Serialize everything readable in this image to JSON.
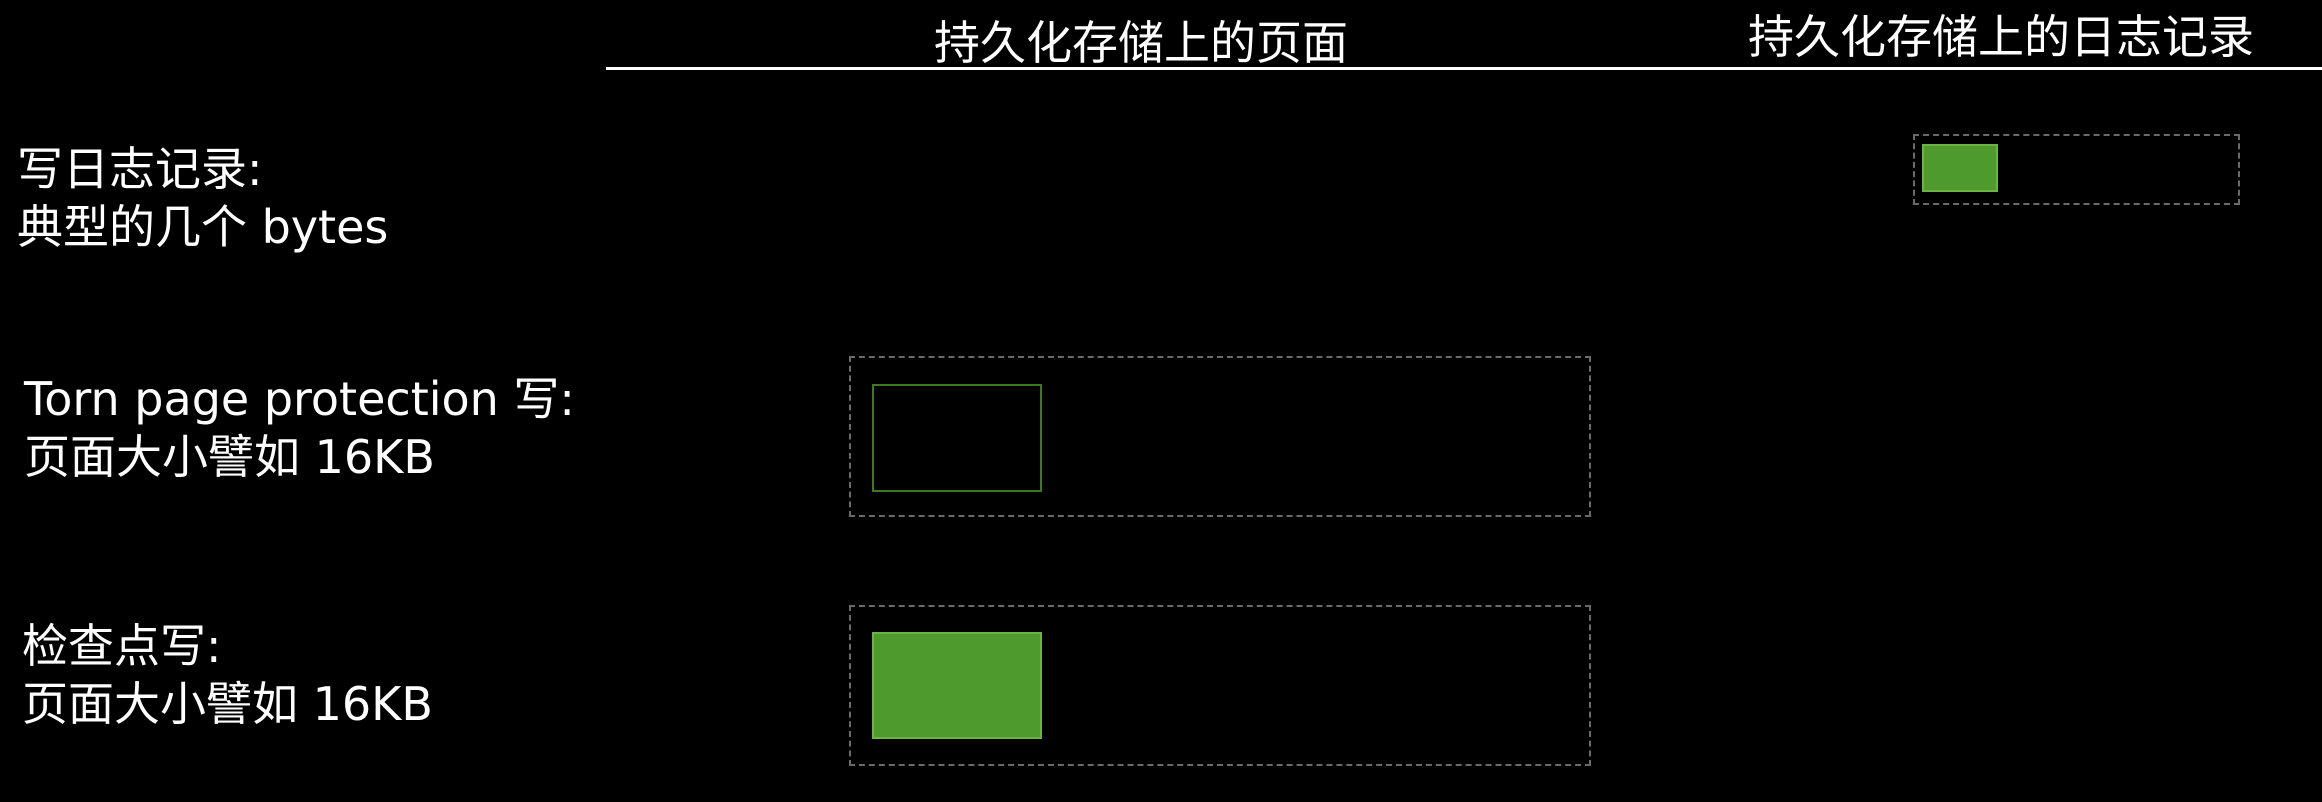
{
  "headers": {
    "pages_on_storage": "持久化存储上的页面",
    "logs_on_storage": "持久化存储上的日志记录"
  },
  "rows": [
    {
      "line1": "写日志记录:",
      "line2": "典型的几个 bytes",
      "block_state": "filled"
    },
    {
      "line1": "Torn page protection 写:",
      "line2": "页面大小譬如 16KB",
      "block_state": "empty"
    },
    {
      "line1": "检查点写:",
      "line2": "页面大小譬如 16KB",
      "block_state": "filled"
    }
  ],
  "colors": {
    "background": "#000000",
    "text": "#ffffff",
    "block_fill": "#4e9a2c",
    "block_outline": "#3b7a1e",
    "slot_border": "#6a6a6a"
  }
}
